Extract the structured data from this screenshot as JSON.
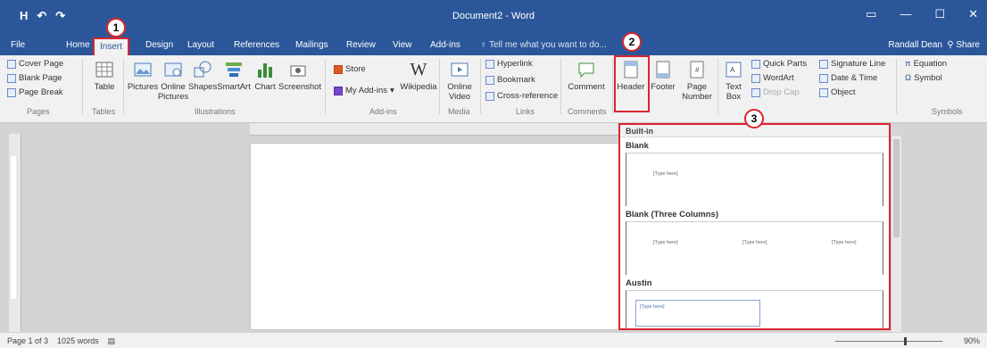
{
  "window": {
    "title": "Document2 - Word",
    "user": "Randall Dean",
    "share_label": "Share",
    "tell_me_placeholder": "Tell me what you want to do...",
    "qat": [
      "H",
      "↶",
      "↷"
    ]
  },
  "tabs": [
    "File",
    "Home",
    "Insert",
    "Design",
    "Layout",
    "References",
    "Mailings",
    "Review",
    "View",
    "Add-ins"
  ],
  "active_tab": "Insert",
  "ribbon": {
    "pages": {
      "label": "Pages",
      "items": [
        "Cover Page",
        "Blank Page",
        "Page Break"
      ]
    },
    "tables": {
      "label": "Tables",
      "items": [
        "Table"
      ]
    },
    "illustrations": {
      "label": "Illustrations",
      "items": [
        "Pictures",
        "Online Pictures",
        "Shapes",
        "SmartArt",
        "Chart",
        "Screenshot"
      ]
    },
    "addins": {
      "label": "Add-ins",
      "items": [
        "Store",
        "My Add-ins",
        "Wikipedia"
      ]
    },
    "media": {
      "label": "Media",
      "items": [
        "Online Video"
      ]
    },
    "links": {
      "label": "Links",
      "items": [
        "Hyperlink",
        "Bookmark",
        "Cross-reference"
      ]
    },
    "comments": {
      "label": "Comments",
      "items": [
        "Comment"
      ]
    },
    "header_footer": {
      "items": [
        "Header",
        "Footer",
        "Page Number"
      ]
    },
    "text": {
      "items": [
        "Text Box",
        "Quick Parts",
        "WordArt",
        "Drop Cap",
        "Signature Line",
        "Date & Time",
        "Object"
      ]
    },
    "symbols": {
      "label": "Symbols",
      "items": [
        "Equation",
        "Symbol"
      ]
    }
  },
  "dropdown": {
    "section": "Built-in",
    "options": [
      "Blank",
      "Blank (Three Columns)",
      "Austin"
    ],
    "placeholder": "[Type here]"
  },
  "callouts": [
    "1",
    "2",
    "3"
  ],
  "status": {
    "page": "Page 1 of 3",
    "words": "1025 words",
    "zoom": "90%"
  },
  "colors": {
    "accent": "#2b579a",
    "highlight": "#d9262e"
  }
}
